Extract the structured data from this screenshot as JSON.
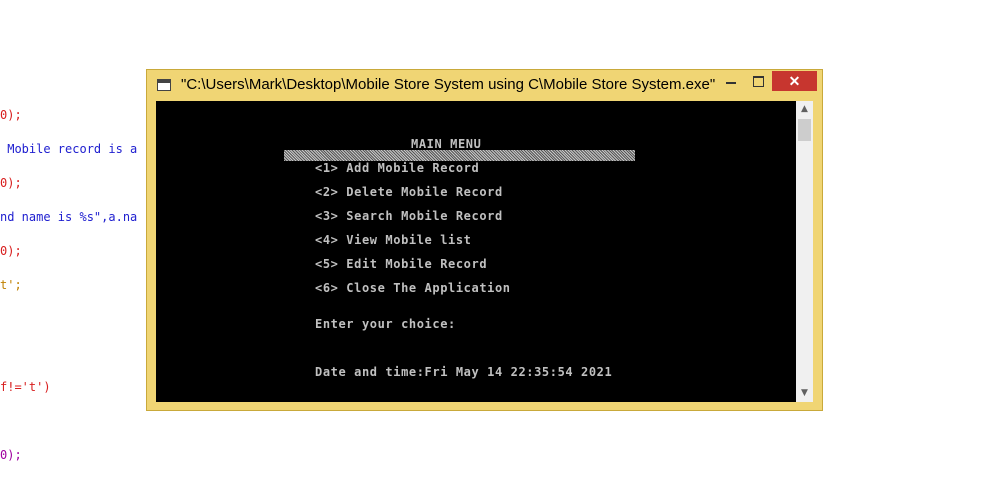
{
  "background_code": [
    {
      "text": "0);",
      "color": "red"
    },
    {
      "text": " Mobile record is a",
      "color": "blue"
    },
    {
      "text": "0);",
      "color": "red"
    },
    {
      "text": "nd name is %s\",a.na",
      "color": "mixed"
    },
    {
      "text": "0);",
      "color": "red"
    },
    {
      "text": "t';",
      "color": "orange"
    },
    {
      "text": "f!='t')",
      "color": "mixed2"
    },
    {
      "text": "0);",
      "color": "purple"
    }
  ],
  "window": {
    "title": "\"C:\\Users\\Mark\\Desktop\\Mobile Store System using C\\Mobile Store System.exe\"",
    "close_glyph": "✕"
  },
  "console": {
    "menu_title": "MAIN MENU",
    "menu_items": [
      "<1> Add Mobile Record",
      "<2> Delete Mobile Record",
      "<3> Search Mobile Record",
      "<4> View Mobile list",
      "<5> Edit Mobile Record",
      "<6> Close The Application"
    ],
    "prompt": "Enter your choice:",
    "datetime": "Date and time:Fri May 14 22:35:54 2021"
  },
  "scrollbar": {
    "up_glyph": "▲",
    "down_glyph": "▼"
  }
}
